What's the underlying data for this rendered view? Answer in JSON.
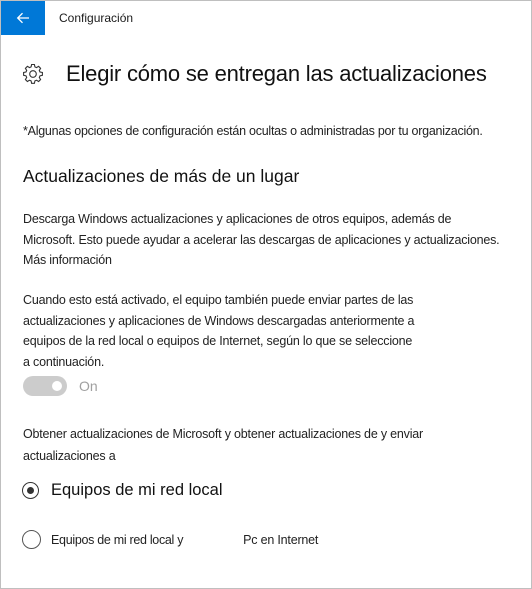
{
  "header": {
    "back_icon": "back-arrow-icon",
    "accent_color": "#0078d7",
    "title": "Configuración"
  },
  "page": {
    "icon": "gear-icon",
    "title": "Elegir cómo se entregan las actualizaciones",
    "notice": "*Algunas opciones de configuración están ocultas o administradas por tu organización."
  },
  "section": {
    "title": "Actualizaciones de más de un lugar",
    "description_line1": "Descarga Windows actualizaciones y aplicaciones de otros equipos, además de",
    "description_line2": "Microsoft. Esto puede ayudar a acelerar las descargas de aplicaciones y actualizaciones.",
    "more_info_link": "Más información",
    "details_line1": "Cuando esto está activado, el equipo también puede enviar partes de las",
    "details_line2": "actualizaciones y aplicaciones de Windows descargadas anteriormente a",
    "details_line3": "equipos de la red local o equipos de Internet, según lo que se seleccione",
    "details_line4": "a continuación.",
    "toggle": {
      "state_label": "On",
      "on": true,
      "disabled": true
    },
    "options_prompt_line1": "Obtener actualizaciones de Microsoft y obtener actualizaciones de y enviar",
    "options_prompt_line2": "actualizaciones a",
    "options": [
      {
        "label": "Equipos de mi red local",
        "selected": true
      },
      {
        "label": "Equipos de mi red local y",
        "label_part2": "Pc en Internet",
        "selected": false
      }
    ]
  }
}
